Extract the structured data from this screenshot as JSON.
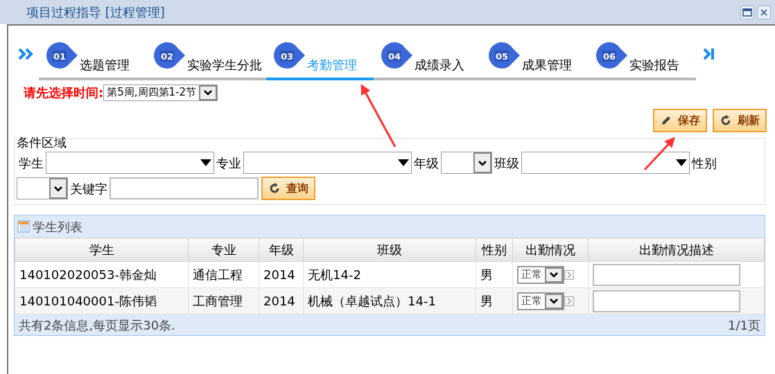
{
  "window": {
    "title": "项目过程指导 [过程管理]"
  },
  "steps": [
    {
      "number": "01",
      "label": "选题管理",
      "selected": false
    },
    {
      "number": "02",
      "label": "实验学生分批",
      "selected": false
    },
    {
      "number": "03",
      "label": "考勤管理",
      "selected": true
    },
    {
      "number": "04",
      "label": "成绩录入",
      "selected": false
    },
    {
      "number": "05",
      "label": "成果管理",
      "selected": false
    },
    {
      "number": "06",
      "label": "实验报告",
      "selected": false
    }
  ],
  "time_filter": {
    "label": "请先选择时间:",
    "value": "第5周,周四第1-2节"
  },
  "toolbar_buttons": [
    {
      "label": "保存",
      "kind": "edit"
    },
    {
      "label": "刷新",
      "kind": "refresh"
    }
  ],
  "conditions": {
    "legend": "条件区域",
    "fields": [
      {
        "label": "学生",
        "kind": "combo"
      },
      {
        "label": "专业",
        "kind": "combo"
      },
      {
        "label": "年级",
        "kind": "select"
      },
      {
        "label": "班级",
        "kind": "combo"
      },
      {
        "label": "性别",
        "kind": "select"
      },
      {
        "label": "关键字",
        "kind": "text"
      }
    ],
    "search_button": "查询"
  },
  "student_list": {
    "title": "学生列表",
    "columns": [
      "学生",
      "专业",
      "年级",
      "班级",
      "性别",
      "出勤情况",
      "出勤情况描述"
    ],
    "rows": [
      {
        "student": "140102020053-韩金灿",
        "major": "通信工程",
        "grade": "2014",
        "class": "无机14-2",
        "gender": "男",
        "attendance": "正常"
      },
      {
        "student": "140101040001-陈伟韬",
        "major": "工商管理",
        "grade": "2014",
        "class": "机械（卓越试点）14-1",
        "gender": "男",
        "attendance": "正常"
      }
    ],
    "summary": "共有2条信息,每页显示30条.",
    "pages": "1/1页"
  }
}
